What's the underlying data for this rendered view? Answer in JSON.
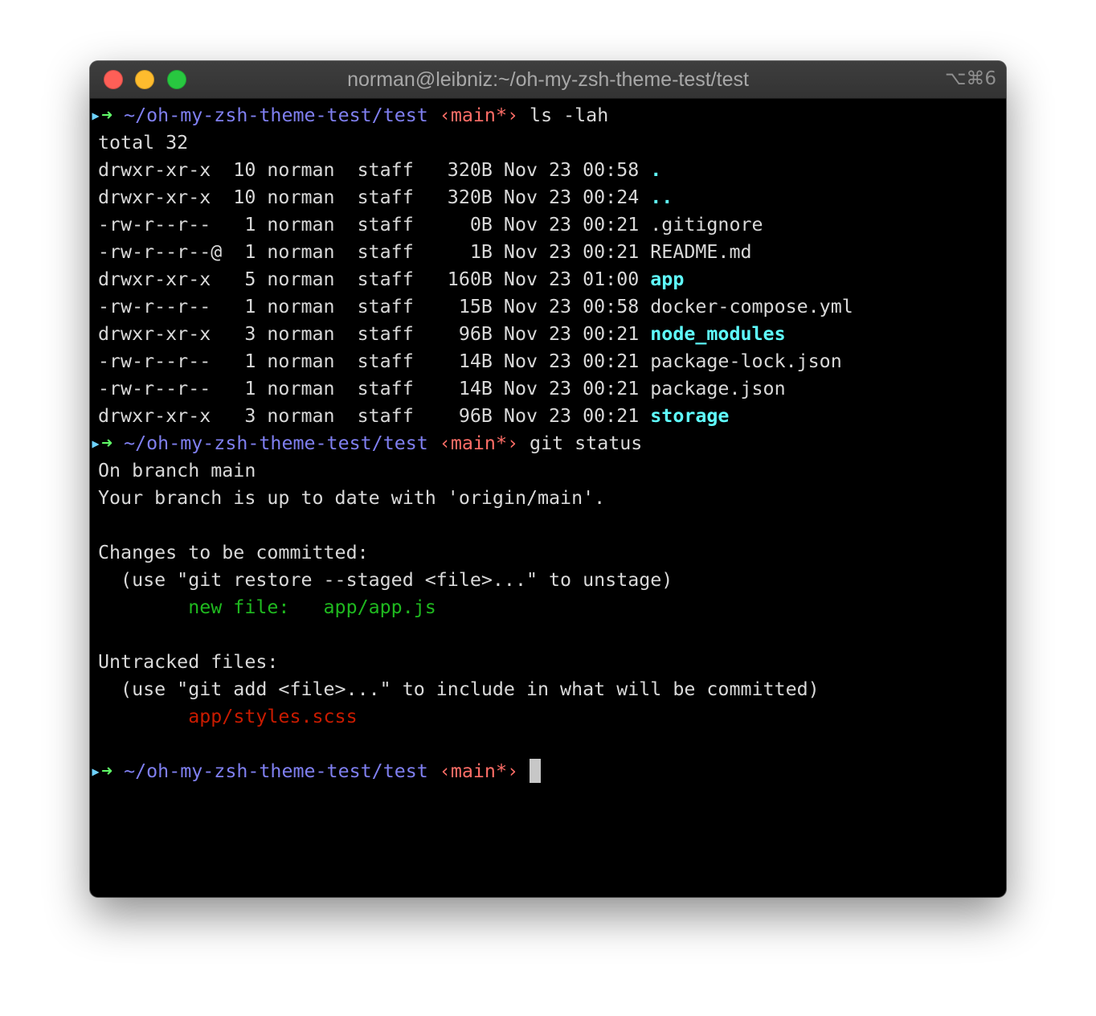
{
  "window": {
    "title": "norman@leibniz:~/oh-my-zsh-theme-test/test",
    "shortcut": "⌥⌘6"
  },
  "colors": {
    "prompt_arrow": "#5ff967",
    "prompt_cwd": "#7f7ff0",
    "prompt_branch": "#ff6e67",
    "dir_listing": "#5ffdff",
    "staged_file": "#1fb91f",
    "untracked_file": "#c91b00",
    "background": "#000000"
  },
  "prompt": {
    "arrow": "➜",
    "cwd": "~/oh-my-zsh-theme-test/test",
    "branch": "‹main*›"
  },
  "session": {
    "cmd1": "ls -lah",
    "total": "total 32",
    "listing": [
      {
        "meta": "drwxr-xr-x  10 norman  staff   320B Nov 23 00:58 ",
        "name": ".",
        "kind": "dot"
      },
      {
        "meta": "drwxr-xr-x  10 norman  staff   320B Nov 23 00:24 ",
        "name": "..",
        "kind": "dot"
      },
      {
        "meta": "-rw-r--r--   1 norman  staff     0B Nov 23 00:21 ",
        "name": ".gitignore",
        "kind": "file"
      },
      {
        "meta": "-rw-r--r--@  1 norman  staff     1B Nov 23 00:21 ",
        "name": "README.md",
        "kind": "file"
      },
      {
        "meta": "drwxr-xr-x   5 norman  staff   160B Nov 23 01:00 ",
        "name": "app",
        "kind": "dir"
      },
      {
        "meta": "-rw-r--r--   1 norman  staff    15B Nov 23 00:58 ",
        "name": "docker-compose.yml",
        "kind": "file"
      },
      {
        "meta": "drwxr-xr-x   3 norman  staff    96B Nov 23 00:21 ",
        "name": "node_modules",
        "kind": "dir"
      },
      {
        "meta": "-rw-r--r--   1 norman  staff    14B Nov 23 00:21 ",
        "name": "package-lock.json",
        "kind": "file"
      },
      {
        "meta": "-rw-r--r--   1 norman  staff    14B Nov 23 00:21 ",
        "name": "package.json",
        "kind": "file"
      },
      {
        "meta": "drwxr-xr-x   3 norman  staff    96B Nov 23 00:21 ",
        "name": "storage",
        "kind": "dir"
      }
    ],
    "cmd2": "git status",
    "status": {
      "branch_line": "On branch main",
      "uptodate_line": "Your branch is up to date with 'origin/main'.",
      "changes_header": "Changes to be committed:",
      "changes_hint": "  (use \"git restore --staged <file>...\" to unstage)",
      "staged_label": "        new file:   ",
      "staged_file": "app/app.js",
      "untracked_header": "Untracked files:",
      "untracked_hint": "  (use \"git add <file>...\" to include in what will be committed)",
      "untracked_indent": "        ",
      "untracked_file": "app/styles.scss"
    }
  }
}
